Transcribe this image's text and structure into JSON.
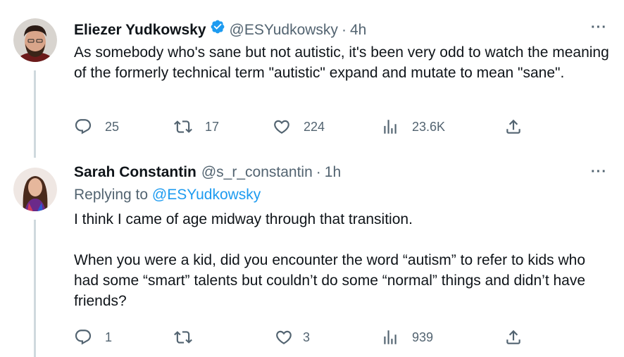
{
  "tweets": [
    {
      "name": "Eliezer Yudkowsky",
      "handle": "@ESYudkowsky",
      "separator": "·",
      "time": "4h",
      "verified": true,
      "more": "···",
      "text": "As somebody who's sane but not autistic, it's been very odd to watch the meaning of the formerly technical term \"autistic\" expand and mutate to mean \"sane\".",
      "replies": "25",
      "retweets": "17",
      "likes": "224",
      "views": "23.6K"
    },
    {
      "name": "Sarah Constantin",
      "handle": "@s_r_constantin",
      "separator": "·",
      "time": "1h",
      "more": "···",
      "replying_prefix": "Replying to ",
      "replying_to": "@ESYudkowsky",
      "text": "I think I came of age midway through that transition.\n\nWhen you were a kid, did you encounter the word “autism” to refer to kids who had some “smart” talents but couldn’t do some “normal” things and didn’t have friends?",
      "replies": "1",
      "retweets": "",
      "likes": "3",
      "views": "939"
    }
  ],
  "colors": {
    "text": "#0f1419",
    "secondary": "#536471",
    "link": "#1d9bf0",
    "verified": "#1d9bf0",
    "thread_line": "#cfd9de"
  },
  "icons": [
    "reply-icon",
    "retweet-icon",
    "like-icon",
    "views-icon",
    "share-icon",
    "verified-badge-icon",
    "more-icon"
  ]
}
